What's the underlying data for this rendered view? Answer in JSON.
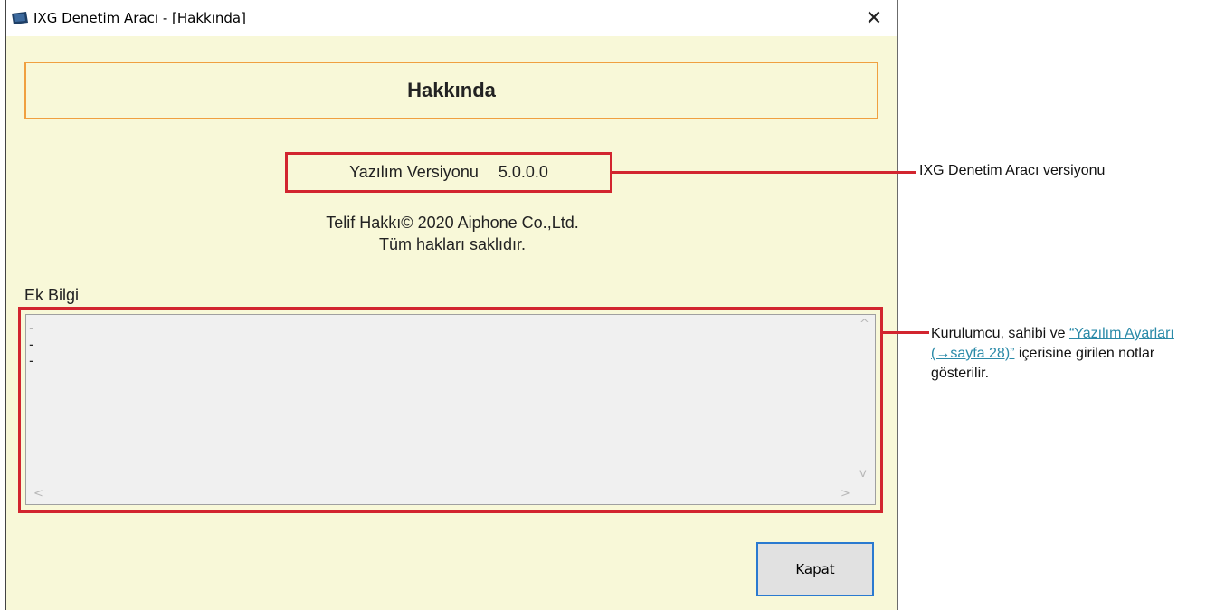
{
  "window": {
    "title": "IXG Denetim Aracı - [Hakkında]",
    "close_glyph": "✕"
  },
  "header": {
    "title": "Hakkında"
  },
  "version": {
    "label": "Yazılım Versiyonu",
    "value": "5.0.0.0"
  },
  "copyright": {
    "line1": "Telif Hakkı© 2020 Aiphone Co.,Ltd.",
    "line2": "Tüm hakları saklıdır."
  },
  "ek_bilgi": {
    "label": "Ek Bilgi",
    "lines": [
      "-",
      "-",
      "-"
    ]
  },
  "buttons": {
    "close_label": "Kapat"
  },
  "callouts": {
    "version_note": "IXG Denetim Aracı versiyonu",
    "info_note_prefix": "Kurulumcu, sahibi ve ",
    "info_note_link": "“Yazılım Ayarları (→sayfa 28)”",
    "info_note_suffix": " içerisine girilen notlar gösterilir."
  },
  "colors": {
    "highlight": "#d2252f",
    "header_border": "#f0a040",
    "window_bg": "#f8f8d8",
    "link": "#2a8aa8"
  }
}
